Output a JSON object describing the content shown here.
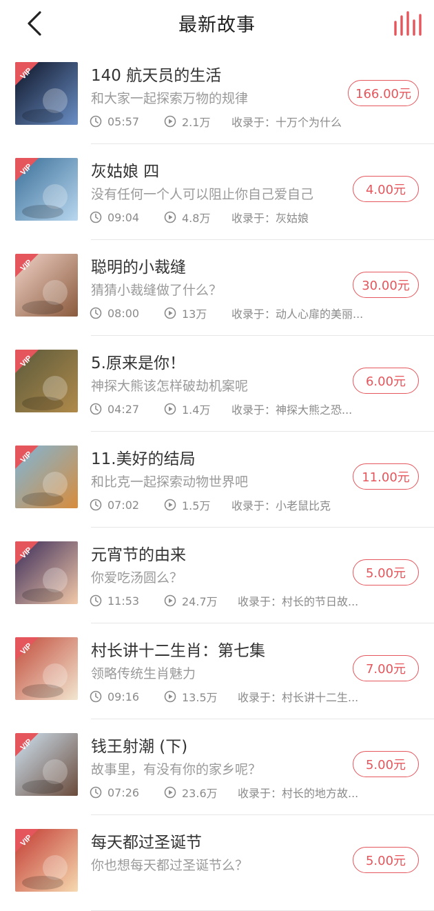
{
  "header": {
    "title": "最新故事"
  },
  "cover_badge": "VIP",
  "accent_color": "#e4565c",
  "items": [
    {
      "title": "140 航天员的生活",
      "subtitle": "和大家一起探索万物的规律",
      "duration": "05:57",
      "plays": "2.1万",
      "collection": "收录于：十万个为什么",
      "price": "166.00元"
    },
    {
      "title": "灰姑娘 四",
      "subtitle": "没有任何一个人可以阻止你自己爱自己",
      "duration": "09:04",
      "plays": "4.8万",
      "collection": "收录于：灰姑娘",
      "price": "4.00元"
    },
    {
      "title": "聪明的小裁缝",
      "subtitle": "猜猜小裁缝做了什么？",
      "duration": "08:00",
      "plays": "13万",
      "collection": "收录于：动人心扉的美丽...",
      "price": "30.00元"
    },
    {
      "title": "5.原来是你！",
      "subtitle": "神探大熊该怎样破劫机案呢",
      "duration": "04:27",
      "plays": "1.4万",
      "collection": "收录于：神探大熊之恐...",
      "price": "6.00元"
    },
    {
      "title": "11.美好的结局",
      "subtitle": "和比克一起探索动物世界吧",
      "duration": "07:02",
      "plays": "1.5万",
      "collection": "收录于：小老鼠比克",
      "price": "11.00元"
    },
    {
      "title": "元宵节的由来",
      "subtitle": "你爱吃汤圆么？",
      "duration": "11:53",
      "plays": "24.7万",
      "collection": "收录于：村长的节日故...",
      "price": "5.00元"
    },
    {
      "title": "村长讲十二生肖：第七集",
      "subtitle": "领略传统生肖魅力",
      "duration": "09:16",
      "plays": "13.5万",
      "collection": "收录于：村长讲十二生...",
      "price": "7.00元"
    },
    {
      "title": "钱王射潮 (下)",
      "subtitle": "故事里，有没有你的家乡呢？",
      "duration": "07:26",
      "plays": "23.6万",
      "collection": "收录于：村长的地方故...",
      "price": "5.00元"
    },
    {
      "title": "每天都过圣诞节",
      "subtitle": "你也想每天都过圣诞节么？",
      "duration": "",
      "plays": "",
      "collection": "",
      "price": "5.00元"
    }
  ],
  "cover_colors": [
    [
      "#0e1426",
      "#6a8fc6"
    ],
    [
      "#3a6f98",
      "#b9d7ef"
    ],
    [
      "#f0d2c8",
      "#8a5a3c"
    ],
    [
      "#5b5a3c",
      "#b08a4a"
    ],
    [
      "#7fb6d8",
      "#d88c3c"
    ],
    [
      "#3a2c5a",
      "#f2c8a8"
    ],
    [
      "#c24c3c",
      "#f2e6d0"
    ],
    [
      "#cfe4f3",
      "#6a4a3a"
    ],
    [
      "#c23a32",
      "#f6d9b0"
    ]
  ],
  "icons": {
    "back": "chevron-left-icon",
    "equalizer": "equalizer-bars-icon",
    "duration": "clock-icon",
    "plays": "play-circle-icon"
  }
}
